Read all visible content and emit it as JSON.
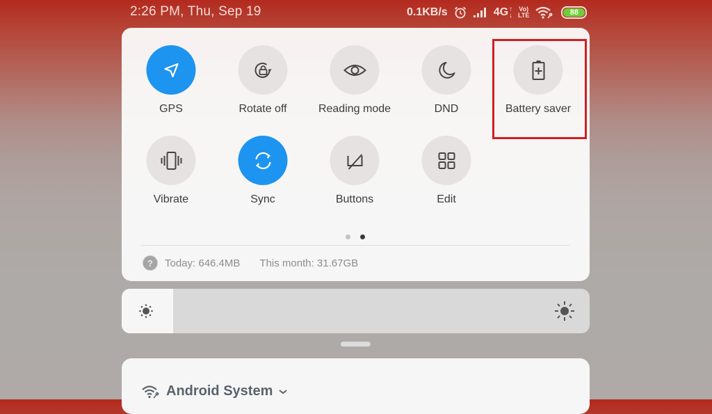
{
  "status_bar": {
    "datetime": "2:26 PM, Thu, Sep 19",
    "network_speed": "0.1KB/s",
    "alarm_icon": "alarm-clock-icon",
    "signal_icon": "cell-signal-icon",
    "network_type": "4G",
    "volte_top": "Vo)",
    "volte_bottom": "LTE",
    "wifi_icon": "wifi-icon",
    "battery_level": "88",
    "battery_color": "#6fcf3a"
  },
  "quick_settings": {
    "accent_color": "#1d94f0",
    "tiles": [
      {
        "label": "GPS",
        "icon": "navigation-arrow-icon",
        "active": true
      },
      {
        "label": "Rotate off",
        "icon": "rotation-lock-icon",
        "active": false
      },
      {
        "label": "Reading mode",
        "icon": "eye-icon",
        "active": false
      },
      {
        "label": "DND",
        "icon": "moon-icon",
        "active": false
      },
      {
        "label": "Battery saver",
        "icon": "battery-plus-icon",
        "active": false,
        "highlighted": true
      },
      {
        "label": "Vibrate",
        "icon": "vibrate-icon",
        "active": false
      },
      {
        "label": "Sync",
        "icon": "sync-icon",
        "active": true
      },
      {
        "label": "Buttons",
        "icon": "buttons-icon",
        "active": false
      },
      {
        "label": "Edit",
        "icon": "grid-icon",
        "active": false
      }
    ],
    "highlight_color": "#d21f22",
    "page_count": 2,
    "current_page": 2,
    "data_usage": {
      "today": "Today: 646.4MB",
      "month": "This month: 31.67GB"
    }
  },
  "brightness": {
    "level_percent": 11
  },
  "notification": {
    "app_name": "Android System",
    "app_icon": "wifi-icon"
  }
}
